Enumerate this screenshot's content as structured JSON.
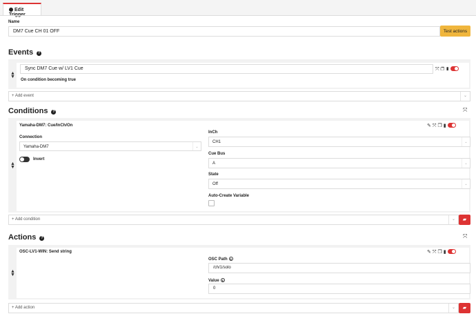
{
  "tab": {
    "label": "Edit Trigger"
  },
  "name": {
    "label": "Name",
    "value": "DM7 Cue CH 01 OFF",
    "test_button": "Test actions"
  },
  "events": {
    "heading": "Events",
    "item": {
      "value": "Sync DM7 Cue w/ LV1 Cue",
      "condition_text": "On condition becoming true"
    },
    "add_placeholder": "+ Add event"
  },
  "conditions": {
    "heading": "Conditions",
    "item": {
      "title": "Yamaha-DM7: Cue/InCh/On",
      "connection_label": "Connection",
      "connection_value": "Yamaha-DM7",
      "invert_label": "Invert",
      "inch_label": "InCh",
      "inch_value": "CH1",
      "cuebus_label": "Cue Bus",
      "cuebus_value": "A",
      "state_label": "State",
      "state_value": "Off",
      "autocreate_label": "Auto-Create Variable"
    },
    "add_placeholder": "+ Add condition"
  },
  "actions": {
    "heading": "Actions",
    "item": {
      "title": "OSC-LV1-WIN: Send string",
      "path_label": "OSC Path",
      "path_value": "/ch/1/solo",
      "value_label": "Value",
      "value_value": "0"
    },
    "add_placeholder": "+ Add action"
  },
  "colors": {
    "accent_red": "#d33333",
    "button_yellow": "#f0b63d"
  },
  "icons": [
    "info-icon",
    "help-icon",
    "drag-handle-icon",
    "expand-icon",
    "duplicate-icon",
    "trash-icon",
    "toggle-icon",
    "edit-icon",
    "chevron-down-icon",
    "folder-icon",
    "variable-icon"
  ]
}
